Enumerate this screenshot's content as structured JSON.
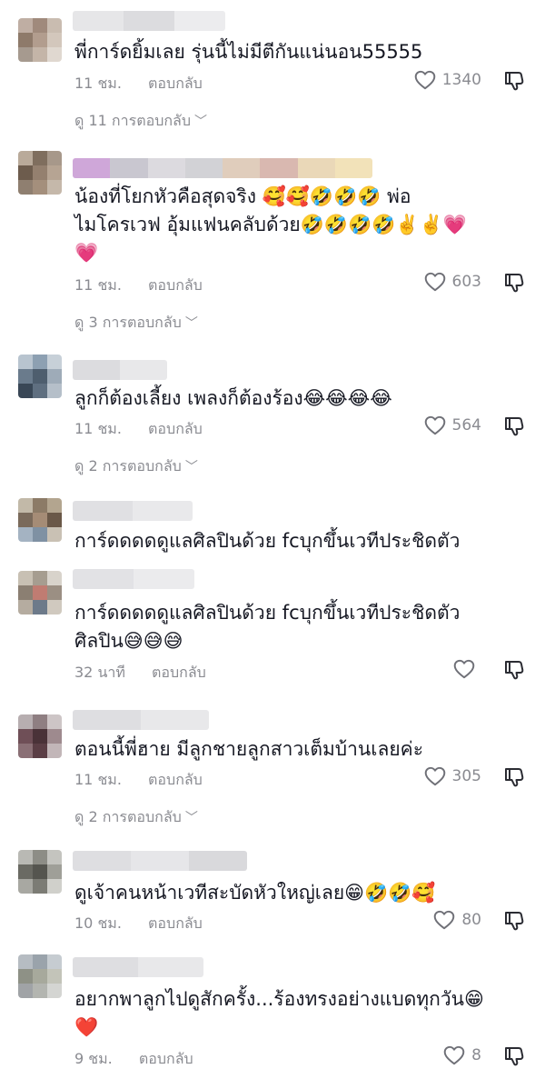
{
  "ui": {
    "reply_label": "ตอบกลับ"
  },
  "comments": [
    {
      "text": "พี่การ์ดยิ้มเลย รุ่นนี้ไม่มีตีกันแน่นอน55555",
      "time": "11 ชม.",
      "likes": "1340",
      "replies": "ดู 11 การตอบกลับ"
    },
    {
      "text": "น้องที่โยกหัวคือสุดจริง 🥰🥰🤣🤣🤣 พ่อ\nไมโครเวฟ อุ้มแฟนคลับด้วย🤣🤣🤣🤣✌️✌️💗\n💗",
      "time": "11 ชม.",
      "likes": "603",
      "replies": "ดู 3 การตอบกลับ"
    },
    {
      "text": "ลูกก็ต้องเลี้ยง เพลงก็ต้องร้อง😂😂😂😂",
      "time": "11 ชม.",
      "likes": "564",
      "replies": "ดู 2 การตอบกลับ"
    },
    {
      "text": "การ์ดดดดดูแลศิลปินด้วย fcบุกขึ้นเวทีประชิดตัว"
    },
    {
      "text": "การ์ดดดดดูแลศิลปินด้วย fcบุกขึ้นเวทีประชิดตัว\nศิลปิน😅😅😅",
      "time": "32 นาที",
      "likes": ""
    },
    {
      "text": "ตอนนี้พี่ฮาย มีลูกชายลูกสาวเต็มบ้านเลยค่ะ",
      "time": "11 ชม.",
      "likes": "305",
      "replies": "ดู 2 การตอบกลับ"
    },
    {
      "text": "ดูเจ้าคนหน้าเวทีสะบัดหัวใหญ่เลย😁🤣🤣🥰",
      "time": "10 ชม.",
      "likes": "80"
    },
    {
      "text": "อยากพาลูกไปดูสักครั้ง...ร้องทรงอย่างแบดทุกวัน😁\n❤️",
      "time": "9 ชม.",
      "likes": "8"
    }
  ]
}
